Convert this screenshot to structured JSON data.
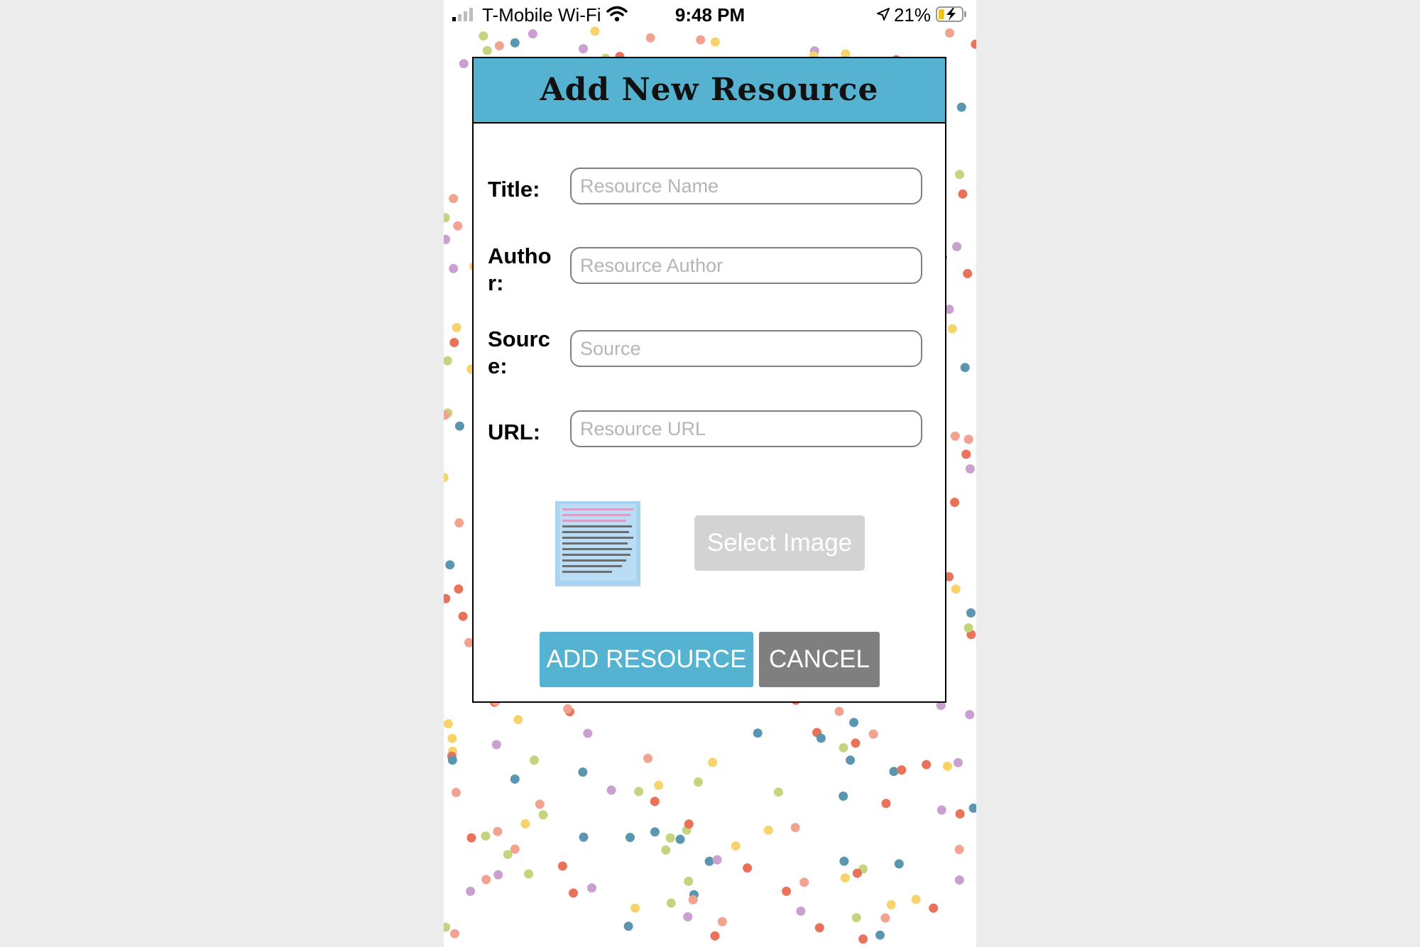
{
  "status_bar": {
    "carrier": "T-Mobile Wi-Fi",
    "time": "9:48 PM",
    "battery_percent": "21%",
    "icons": [
      "signal-icon",
      "wifi-icon",
      "location-icon",
      "battery-charging-icon"
    ]
  },
  "dialog": {
    "title": "Add New Resource",
    "fields": [
      {
        "label": "Title:",
        "placeholder": "Resource Name",
        "value": ""
      },
      {
        "label": "Author:",
        "placeholder": "Resource Author",
        "value": ""
      },
      {
        "label": "Source:",
        "placeholder": "Source",
        "value": ""
      },
      {
        "label": "URL:",
        "placeholder": "Resource URL",
        "value": ""
      }
    ],
    "select_image_label": "Select Image",
    "add_label": "ADD RESOURCE",
    "cancel_label": "CANCEL"
  },
  "colors": {
    "header_background": "#55b2d0",
    "add_button": "#55b2d0",
    "cancel_button": "#7f7f7f",
    "select_image_disabled": "#d3d3d3",
    "confetti": [
      "#e8735a",
      "#f2a38f",
      "#f7d46b",
      "#c7d47e",
      "#5b96b0",
      "#c9a0cf"
    ]
  }
}
